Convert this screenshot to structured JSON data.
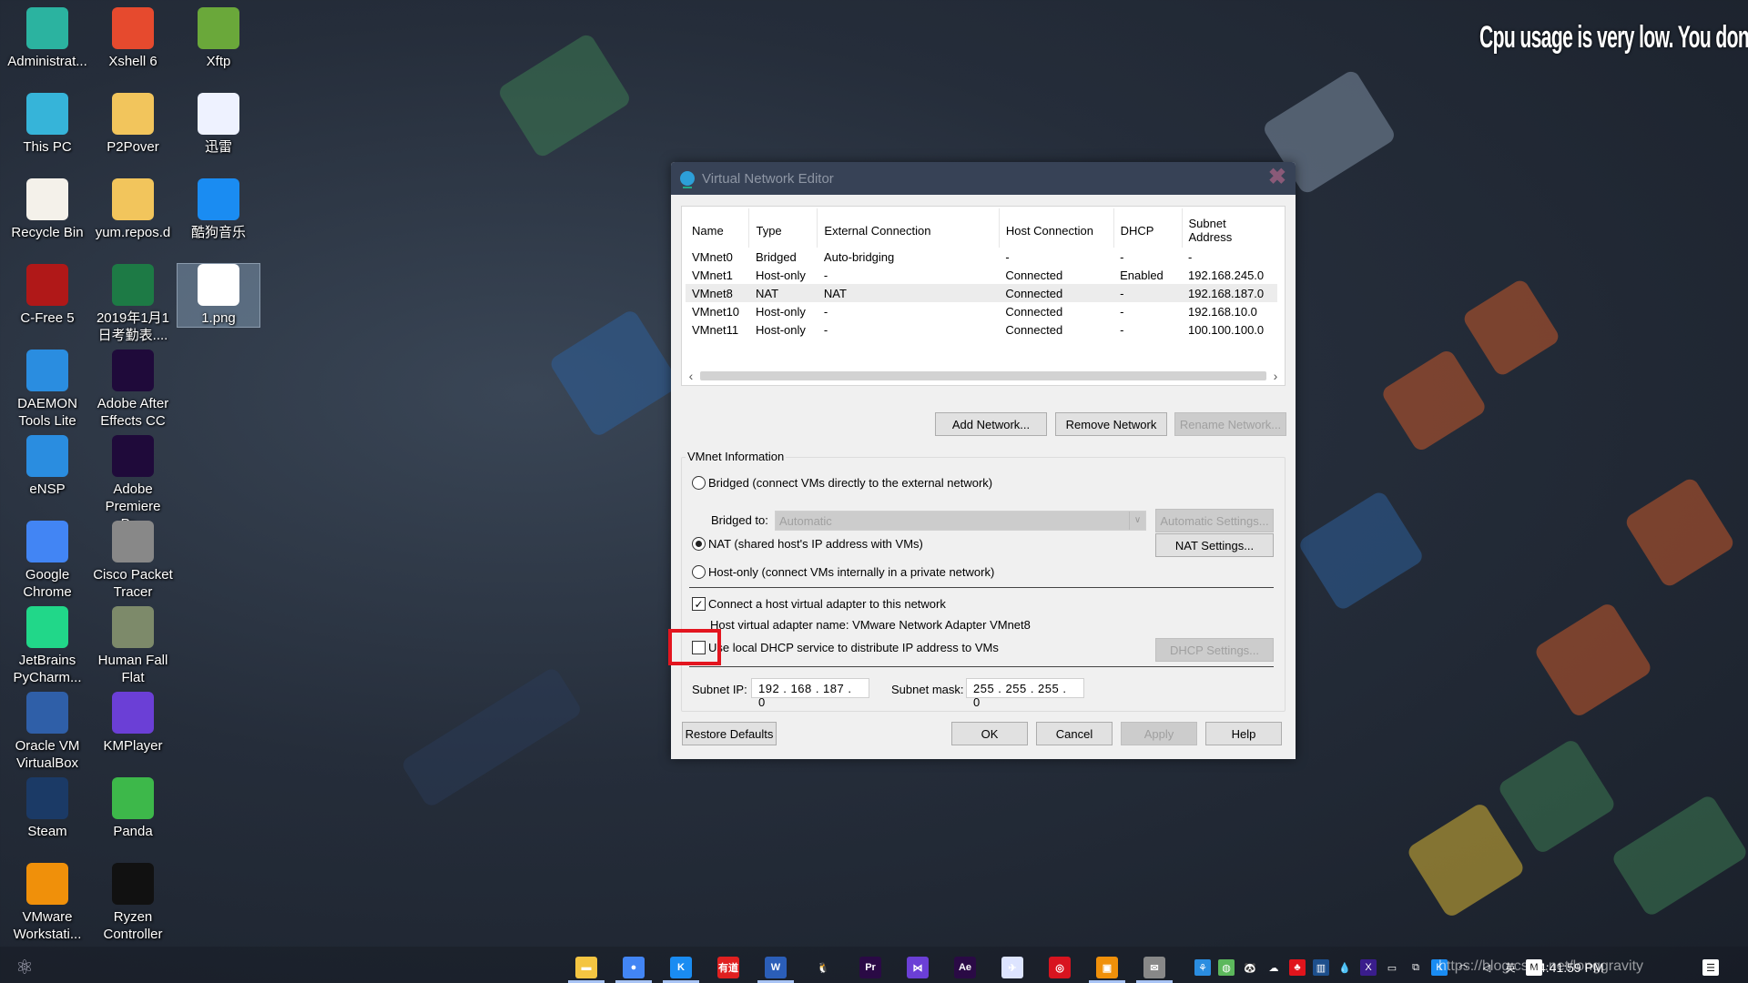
{
  "wallpaper": {
    "caption": "Cpu usage is very low. You don't need to w"
  },
  "desktop": {
    "icons": [
      {
        "label": "Administrat...",
        "icon": "user-folder-icon",
        "color": "#2bb3a0"
      },
      {
        "label": "Xshell 6",
        "icon": "xshell-icon",
        "color": "#e64a2e"
      },
      {
        "label": "Xftp",
        "icon": "xftp-icon",
        "color": "#6aa83a"
      },
      {
        "label": "This PC",
        "icon": "monitor-icon",
        "color": "#36b4d9"
      },
      {
        "label": "P2Pover",
        "icon": "folder-icon",
        "color": "#f2c55c"
      },
      {
        "label": "迅雷",
        "icon": "thunder-bird-icon",
        "color": "#eef2ff"
      },
      {
        "label": "Recycle Bin",
        "icon": "recycle-bin-icon",
        "color": "#f4f1ea"
      },
      {
        "label": "yum.repos.d",
        "icon": "folder-icon",
        "color": "#f2c55c"
      },
      {
        "label": "酷狗音乐",
        "icon": "kugou-icon",
        "color": "#1a8cf2"
      },
      {
        "label": "C-Free 5",
        "icon": "cfree-icon",
        "color": "#b01818"
      },
      {
        "label": "2019年1月1日考勤表....",
        "icon": "excel-file-icon",
        "color": "#1d7a45"
      },
      {
        "label": "1.png",
        "icon": "image-file-icon",
        "color": "#ffffff"
      },
      {
        "label": "DAEMON Tools Lite",
        "icon": "daemon-tools-icon",
        "color": "#2a8de0"
      },
      {
        "label": "Adobe After Effects CC",
        "icon": "after-effects-icon",
        "color": "#1f0a3a"
      },
      {
        "label": "eNSP",
        "icon": "ensp-icon",
        "color": "#2a8de0"
      },
      {
        "label": "Adobe Premiere Pr...",
        "icon": "premiere-icon",
        "color": "#1f0a3a"
      },
      {
        "label": "Google Chrome",
        "icon": "chrome-icon",
        "color": "#4285f4"
      },
      {
        "label": "Cisco Packet Tracer",
        "icon": "packet-tracer-icon",
        "color": "#888888"
      },
      {
        "label": "JetBrains PyCharm...",
        "icon": "pycharm-icon",
        "color": "#21d789"
      },
      {
        "label": "Human Fall Flat",
        "icon": "human-fall-flat-icon",
        "color": "#7d8a6a"
      },
      {
        "label": "Oracle VM VirtualBox",
        "icon": "virtualbox-icon",
        "color": "#2f5fa8"
      },
      {
        "label": "KMPlayer",
        "icon": "kmplayer-icon",
        "color": "#6b3fd6"
      },
      {
        "label": "Steam",
        "icon": "steam-icon",
        "color": "#1b3a66"
      },
      {
        "label": "Panda",
        "icon": "panda-icon",
        "color": "#3db84a"
      },
      {
        "label": "VMware Workstati...",
        "icon": "vmware-icon",
        "color": "#f0900a"
      },
      {
        "label": "Ryzen Controller",
        "icon": "ryzen-icon",
        "color": "#111111"
      }
    ]
  },
  "dialog": {
    "title": "Virtual Network Editor",
    "columns": [
      "Name",
      "Type",
      "External Connection",
      "Host Connection",
      "DHCP",
      "Subnet Address"
    ],
    "rows": [
      [
        "VMnet0",
        "Bridged",
        "Auto-bridging",
        "-",
        "-",
        "-"
      ],
      [
        "VMnet1",
        "Host-only",
        "-",
        "Connected",
        "Enabled",
        "192.168.245.0"
      ],
      [
        "VMnet8",
        "NAT",
        "NAT",
        "Connected",
        "-",
        "192.168.187.0"
      ],
      [
        "VMnet10",
        "Host-only",
        "-",
        "Connected",
        "-",
        "192.168.10.0"
      ],
      [
        "VMnet11",
        "Host-only",
        "-",
        "Connected",
        "-",
        "100.100.100.0"
      ]
    ],
    "selected_row": "VMnet8",
    "buttons": {
      "add_network": "Add Network...",
      "remove_network": "Remove Network",
      "rename_network": "Rename Network...",
      "automatic_settings": "Automatic Settings...",
      "nat_settings": "NAT Settings...",
      "dhcp_settings": "DHCP Settings...",
      "restore_defaults": "Restore Defaults",
      "ok": "OK",
      "cancel": "Cancel",
      "apply": "Apply",
      "help": "Help"
    },
    "vmnet_info": {
      "legend": "VMnet Information",
      "bridged_label": "Bridged (connect VMs directly to the external network)",
      "bridged_to_label": "Bridged to:",
      "bridged_to_value": "Automatic",
      "nat_label": "NAT (shared host's IP address with VMs)",
      "hostonly_label": "Host-only (connect VMs internally in a private network)",
      "selected_mode": "NAT",
      "connect_adapter_label": "Connect a host virtual adapter to this network",
      "connect_adapter_checked": true,
      "adapter_name_text": "Host virtual adapter name: VMware Network Adapter VMnet8",
      "dhcp_label": "Use local DHCP service to distribute IP address to VMs",
      "dhcp_checked": false,
      "subnet_ip_label": "Subnet IP:",
      "subnet_ip": "192 . 168 . 187 .  0",
      "subnet_mask_label": "Subnet mask:",
      "subnet_mask": "255 . 255 . 255 .  0"
    }
  },
  "annotation": {
    "color": "#e3151f"
  },
  "taskbar": {
    "apps": [
      {
        "name": "file-explorer",
        "glyph": "▬",
        "color": "#f4c542",
        "active": true
      },
      {
        "name": "chrome",
        "glyph": "●",
        "color": "#4285f4",
        "active": true
      },
      {
        "name": "kugou",
        "glyph": "K",
        "color": "#1a8cf2",
        "active": true
      },
      {
        "name": "youdao",
        "glyph": "有道",
        "color": "#e02020",
        "active": false
      },
      {
        "name": "word",
        "glyph": "W",
        "color": "#2b5eb8",
        "active": true
      },
      {
        "name": "qq",
        "glyph": "🐧",
        "color": "transparent",
        "active": false
      },
      {
        "name": "premiere",
        "glyph": "Pr",
        "color": "#2a0a45",
        "active": false
      },
      {
        "name": "kmplayer",
        "glyph": "⋈",
        "color": "#6b3fd6",
        "active": false
      },
      {
        "name": "after-effects",
        "glyph": "Ae",
        "color": "#2a0a45",
        "active": false
      },
      {
        "name": "thunder",
        "glyph": "✈",
        "color": "#dde4ff",
        "active": false
      },
      {
        "name": "netease-music",
        "glyph": "◎",
        "color": "#d8141f",
        "active": false
      },
      {
        "name": "vmware",
        "glyph": "▣",
        "color": "#f0900a",
        "active": true
      },
      {
        "name": "packet-tracer",
        "glyph": "✉",
        "color": "#888888",
        "active": true
      }
    ],
    "tray": [
      {
        "name": "network-tool",
        "glyph": "⚘",
        "color": "#2a8de0"
      },
      {
        "name": "app-green",
        "glyph": "◍",
        "color": "#5cb85c"
      },
      {
        "name": "panda",
        "glyph": "🐼",
        "color": "transparent"
      },
      {
        "name": "onedrive",
        "glyph": "☁",
        "color": "transparent"
      },
      {
        "name": "app-red",
        "glyph": "♣",
        "color": "#e0141c"
      },
      {
        "name": "app-blue",
        "glyph": "▥",
        "color": "#1d4f8c"
      },
      {
        "name": "drop",
        "glyph": "💧",
        "color": "transparent"
      },
      {
        "name": "app-purple",
        "glyph": "X",
        "color": "#3a1d8c"
      },
      {
        "name": "battery",
        "glyph": "▭",
        "color": "transparent"
      },
      {
        "name": "display",
        "glyph": "⧉",
        "color": "transparent"
      },
      {
        "name": "kugou",
        "glyph": "K",
        "color": "#1a8cf2"
      },
      {
        "name": "wifi",
        "glyph": "◠",
        "color": "transparent"
      },
      {
        "name": "volume",
        "glyph": "◁",
        "color": "transparent"
      },
      {
        "name": "ime",
        "glyph": "英",
        "color": "transparent"
      },
      {
        "name": "app-m",
        "glyph": "M",
        "color": "#ffffff"
      }
    ],
    "clock": "4:41:59 PM",
    "watermark": "https://blog.csdn.net/longgravity",
    "notification": "☰"
  }
}
